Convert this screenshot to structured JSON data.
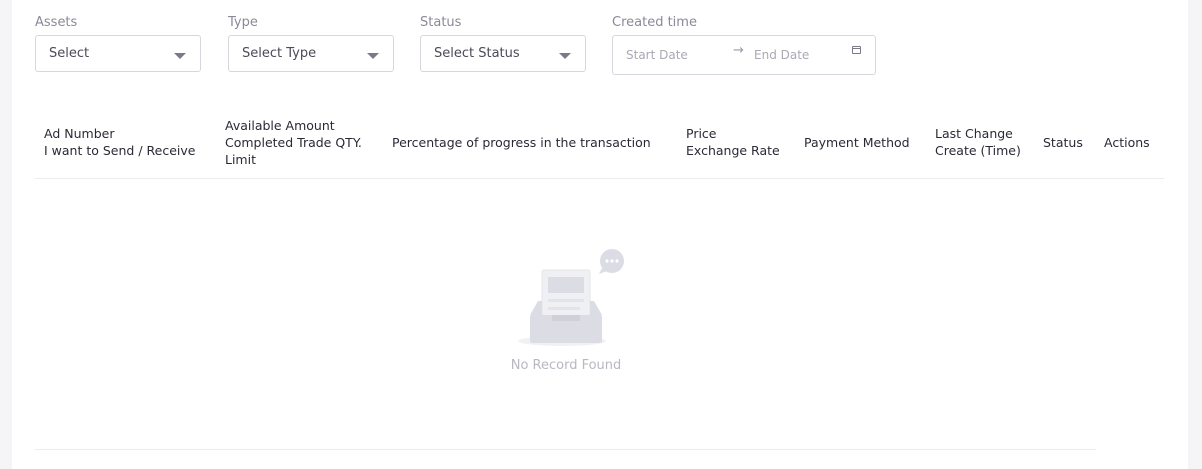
{
  "filters": {
    "assets": {
      "label": "Assets",
      "value": "Select"
    },
    "type": {
      "label": "Type",
      "value": "Select Type"
    },
    "status": {
      "label": "Status",
      "value": "Select Status"
    },
    "created_time": {
      "label": "Created time",
      "start_placeholder": "Start Date",
      "separator": "→",
      "end_placeholder": "End Date"
    }
  },
  "table": {
    "headers": [
      {
        "line1": "Ad Number",
        "line2": "I want to Send / Receive"
      },
      {
        "line1": "Available Amount",
        "line2": "Completed Trade QTY.",
        "line3": "Limit"
      },
      {
        "line1": "Percentage of progress in the transaction"
      },
      {
        "line1": "Price",
        "line2": "Exchange Rate"
      },
      {
        "line1": "Payment Method"
      },
      {
        "line1": "Last Change",
        "line2": "Create (Time)"
      },
      {
        "line1": "Status"
      },
      {
        "line1": "Actions"
      }
    ],
    "empty_text": "No Record Found"
  },
  "colors": {
    "border": "#d6d6de",
    "muted_text": "#8a8a99",
    "empty_illustration": "#e3e4ea"
  },
  "icons": [
    "chevron-down-icon",
    "calendar-icon",
    "empty-inbox-icon",
    "chat-bubble-icon"
  ]
}
